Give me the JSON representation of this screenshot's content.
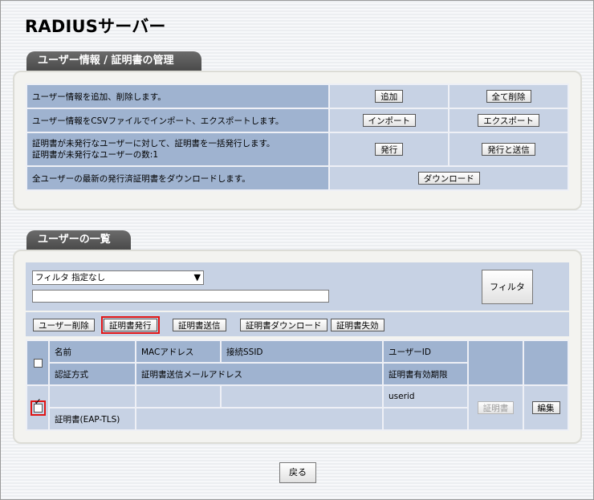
{
  "page": {
    "title": "RADIUSサーバー"
  },
  "management": {
    "section_title": "ユーザー情報 / 証明書の管理",
    "rows": [
      {
        "description": "ユーザー情報を追加、削除します。",
        "actions": [
          "追加",
          "全て削除"
        ]
      },
      {
        "description": "ユーザー情報をCSVファイルでインポート、エクスポートします。",
        "actions": [
          "インポート",
          "エクスポート"
        ]
      },
      {
        "description_line1": "証明書が未発行なユーザーに対して、証明書を一括発行します。",
        "description_line2": "証明書が未発行なユーザーの数:1",
        "actions": [
          "発行",
          "発行と送信"
        ]
      },
      {
        "description": "全ユーザーの最新の発行済証明書をダウンロードします。",
        "actions": [
          "ダウンロード"
        ]
      }
    ]
  },
  "user_list": {
    "section_title": "ユーザーの一覧",
    "filter": {
      "selected": "フィルタ 指定なし",
      "text_value": "",
      "button_label": "フィルタ"
    },
    "toolbar": [
      "ユーザー削除",
      "証明書発行",
      "証明書送信",
      "証明書ダウンロード",
      "証明書失効"
    ],
    "headers": {
      "row1": [
        "名前",
        "MACアドレス",
        "接続SSID",
        "ユーザーID"
      ],
      "row2": [
        "認証方式",
        "証明書送信メールアドレス",
        "証明書有効期限"
      ]
    },
    "entry": {
      "name": "",
      "mac": "",
      "ssid": "",
      "user_id": "userid",
      "auth_method": "証明書(EAP-TLS)",
      "email": "",
      "expiry": "",
      "cert_button": "証明書",
      "edit_button": "編集",
      "checked": true
    }
  },
  "footer": {
    "back_label": "戻る"
  }
}
